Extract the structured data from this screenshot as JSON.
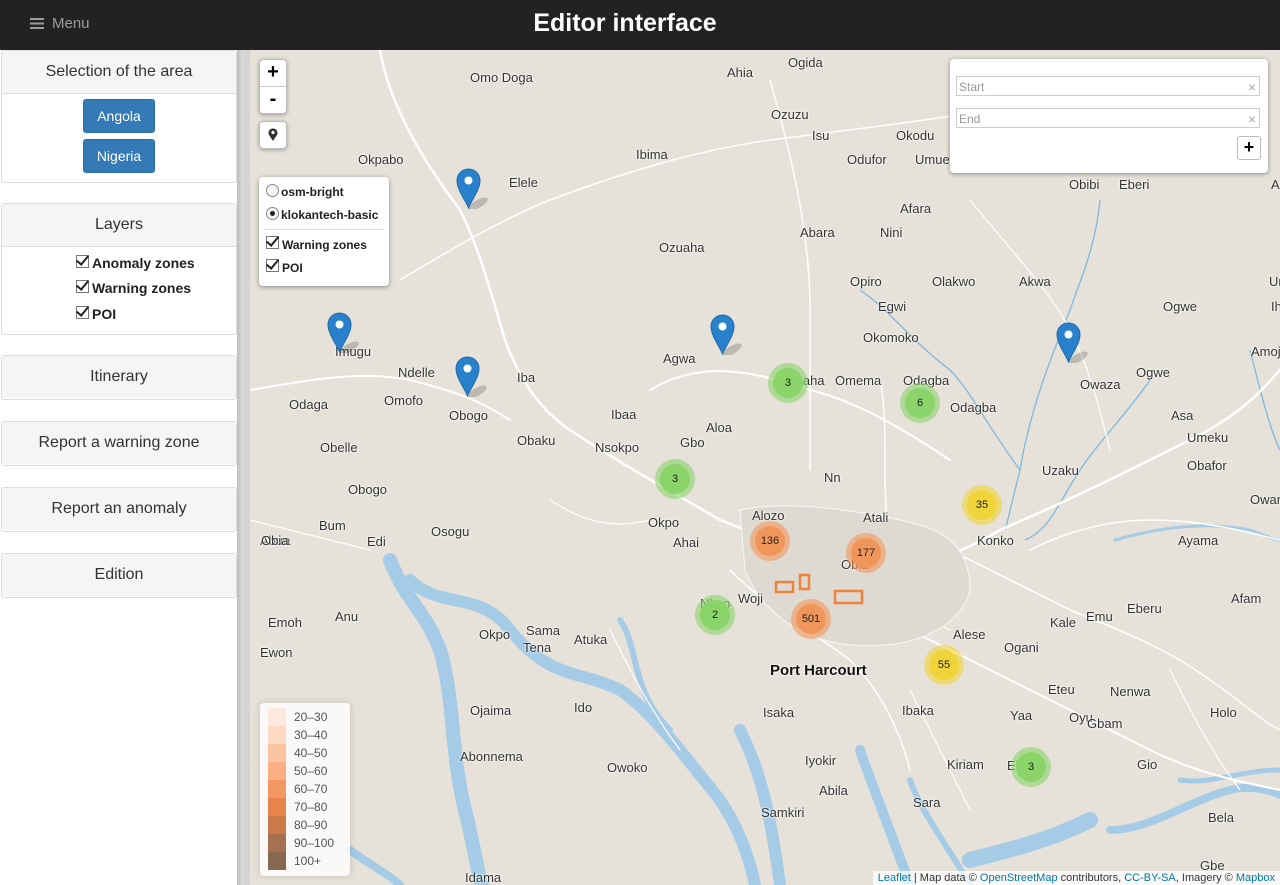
{
  "header": {
    "menu_label": "Menu",
    "title": "Editor interface"
  },
  "sidebar": {
    "area": {
      "title": "Selection of the area",
      "buttons": [
        "Angola",
        "Nigeria"
      ]
    },
    "layers": {
      "title": "Layers",
      "items": [
        {
          "label": "Anomaly zones",
          "checked": true
        },
        {
          "label": "Warning zones",
          "checked": true
        },
        {
          "label": "POI",
          "checked": true
        }
      ]
    },
    "itinerary": {
      "title": "Itinerary"
    },
    "report_warning": {
      "title": "Report a warning zone"
    },
    "report_anomaly": {
      "title": "Report an anomaly"
    },
    "edition": {
      "title": "Edition"
    }
  },
  "map": {
    "zoom_in": "+",
    "zoom_out": "-",
    "base_layers": [
      "osm-bright",
      "klokantech-basic"
    ],
    "selected_base_layer": "klokantech-basic",
    "overlays": [
      "Warning zones",
      "POI"
    ],
    "itinerary": {
      "start_placeholder": "Start",
      "end_placeholder": "End",
      "add_label": "+",
      "clear_label": "×"
    },
    "legend": [
      "20–30",
      "30–40",
      "40–50",
      "50–60",
      "60–70",
      "70–80",
      "80–90",
      "90–100",
      "100+"
    ],
    "legend_colors": [
      "#fde7da",
      "#fcd5bd",
      "#fbbf98",
      "#f9a774",
      "#f18d4f",
      "#e4763a",
      "#c46a34",
      "#9c6040",
      "#7a5840"
    ],
    "clusters": [
      "3",
      "6",
      "3",
      "35",
      "136",
      "177",
      "2",
      "501",
      "55",
      "3"
    ],
    "place_labels": [
      "Omo Doga",
      "Ahia",
      "Ogida",
      "Ozuzu",
      "Isu",
      "Okodu",
      "Okpabo",
      "Ibima",
      "Odufor",
      "Umue",
      "Elele",
      "Obibi",
      "Eberi",
      "Aria",
      "Afara",
      "Abara",
      "Nini",
      "Ozuaha",
      "Opiro",
      "Olakwo",
      "Akwa",
      "Umu",
      "Egwi",
      "Ogwe",
      "Ihie",
      "Imugu",
      "Ndelle",
      "Okomoko",
      "Amoji",
      "Agwa",
      "Ozuaha",
      "Omema",
      "Odagba",
      "Owaza",
      "Ogwe",
      "Odaga",
      "Omofo",
      "Iba",
      "Obogo",
      "Odagba",
      "Asa",
      "Obelle",
      "Ibaa",
      "Aloa",
      "Obaku",
      "Nsokpo",
      "Gbo",
      "Umeku",
      "Uzaku",
      "Obafor",
      "Nn",
      "Obogo",
      "Owan",
      "Alozo",
      "Atali",
      "Bum",
      "Osogu",
      "Okpo",
      "Abua",
      "Edi",
      "Konko",
      "Ayama",
      "Ahai",
      "Obia",
      "Obia",
      "Afam",
      "Woji",
      "Nkpo",
      "Sama",
      "Eberu",
      "Emoh",
      "Anu",
      "Okpo",
      "Atuka",
      "Emu",
      "Kale",
      "Tena",
      "Alese",
      "Ewon",
      "Ogani",
      "Port Harcourt",
      "Eteu",
      "Nenwa",
      "Ojaima",
      "Ido",
      "Isaka",
      "Ibaka",
      "Yaa",
      "Oyu",
      "Gbam",
      "Holo",
      "Abonnema",
      "Ele",
      "Kiriam",
      "Gio",
      "Owoko",
      "Iyokir",
      "Abila",
      "Sara",
      "Samkiri",
      "Bela",
      "Idama",
      "Gbe"
    ],
    "attribution": {
      "leaflet": "Leaflet",
      "map_data": "| Map data ©",
      "osm": "OpenStreetMap",
      "contributors": "contributors,",
      "license": "CC-BY-SA",
      "imagery": ", Imagery ©",
      "mapbox": "Mapbox"
    }
  },
  "colors": {
    "topbar": "#222222",
    "primary_button": "#337ab7",
    "water": "#a6cbe6",
    "cluster_small": "#8bd46a",
    "cluster_medium": "#f0d43a",
    "cluster_large": "#f1965b",
    "marker": "#2a81cb"
  }
}
